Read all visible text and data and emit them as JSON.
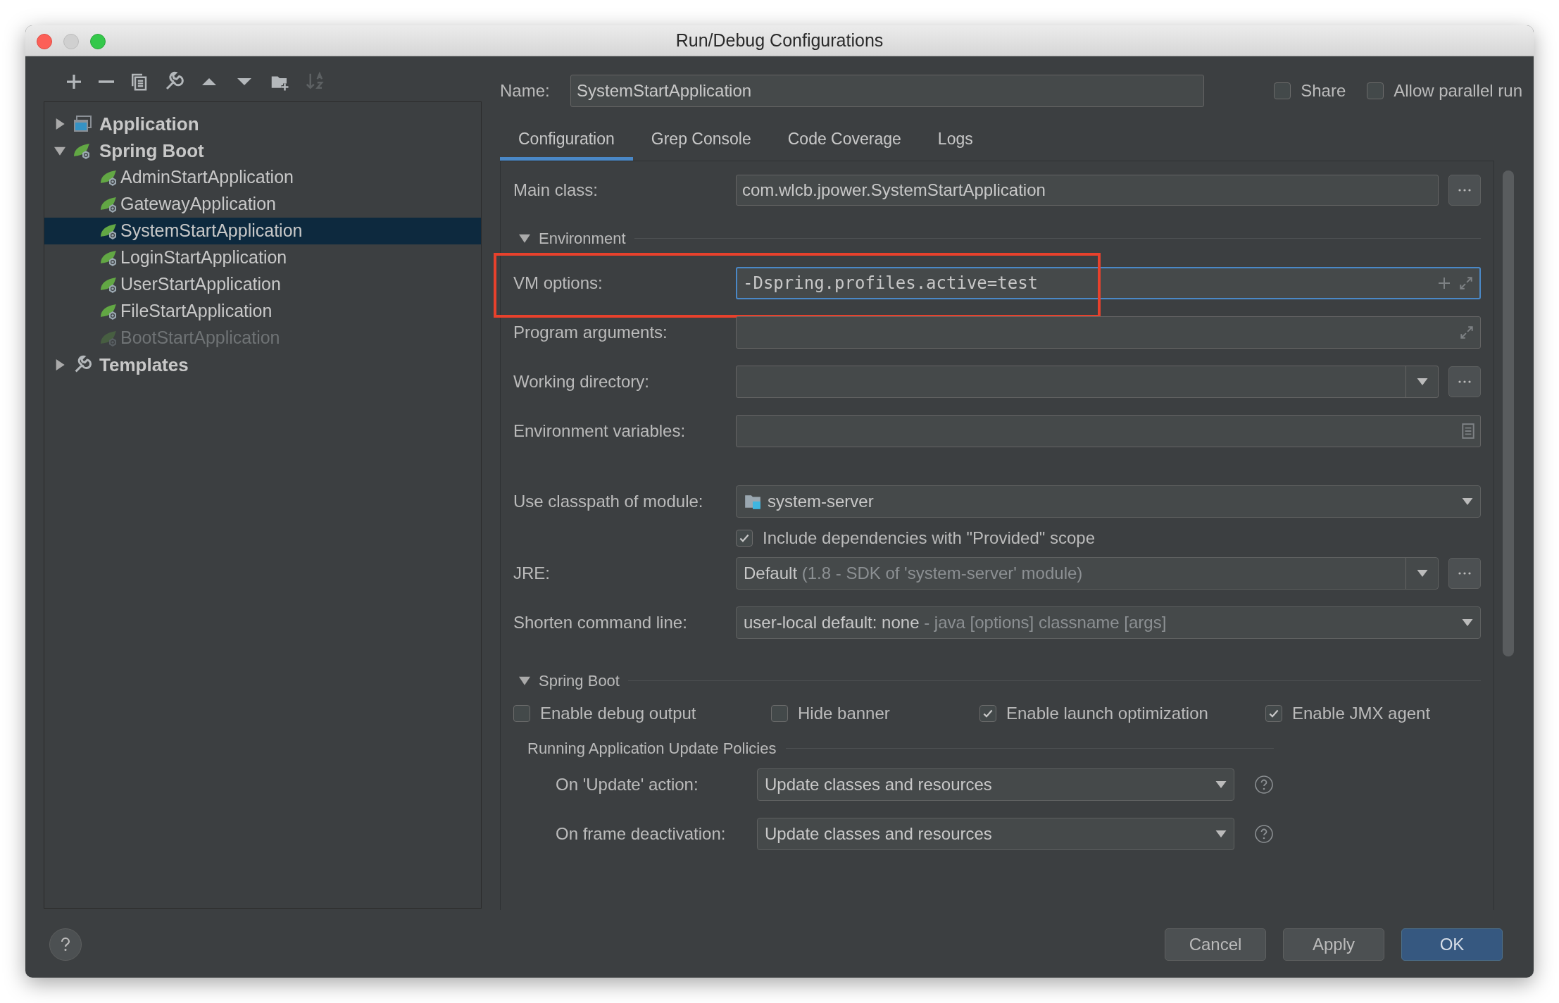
{
  "window": {
    "title": "Run/Debug Configurations"
  },
  "toolbar": [
    {
      "kind": "add",
      "disabled": false
    },
    {
      "kind": "remove",
      "disabled": false
    },
    {
      "kind": "copy",
      "disabled": false
    },
    {
      "kind": "edit",
      "disabled": false
    },
    {
      "kind": "up",
      "disabled": false
    },
    {
      "kind": "down",
      "disabled": false
    },
    {
      "kind": "folder",
      "disabled": false
    },
    {
      "kind": "sort",
      "disabled": true
    }
  ],
  "tree": [
    {
      "label": "Application",
      "kind": "application",
      "expanded": false,
      "selected": false
    },
    {
      "label": "Spring Boot",
      "kind": "spring",
      "expanded": true,
      "selected": false,
      "children": [
        {
          "label": "AdminStartApplication",
          "selected": false,
          "disabled": false
        },
        {
          "label": "GatewayApplication",
          "selected": false,
          "disabled": false
        },
        {
          "label": "SystemStartApplication",
          "selected": true,
          "disabled": false
        },
        {
          "label": "LoginStartApplication",
          "selected": false,
          "disabled": false
        },
        {
          "label": "UserStartApplication",
          "selected": false,
          "disabled": false
        },
        {
          "label": "FileStartApplication",
          "selected": false,
          "disabled": false
        },
        {
          "label": "BootStartApplication",
          "selected": false,
          "disabled": true
        }
      ]
    },
    {
      "label": "Templates",
      "kind": "templates",
      "expanded": false,
      "selected": false
    }
  ],
  "name_field": {
    "label": "Name:",
    "value": "SystemStartApplication"
  },
  "options": [
    {
      "label": "Share",
      "checked": false
    },
    {
      "label": "Allow parallel run",
      "checked": false
    }
  ],
  "tabs": [
    {
      "label": "Configuration",
      "selected": true
    },
    {
      "label": "Grep Console",
      "selected": false
    },
    {
      "label": "Code Coverage",
      "selected": false
    },
    {
      "label": "Logs",
      "selected": false
    }
  ],
  "main_class": {
    "label": "Main class:",
    "value": "com.wlcb.jpower.SystemStartApplication"
  },
  "environment": {
    "title": "Environment",
    "expanded": true,
    "fields": [
      {
        "kind": "options",
        "label": "VM options:",
        "value": "-Dspring.profiles.active=test",
        "focused": true,
        "highlighted": true
      },
      {
        "kind": "arguments",
        "label": "Program arguments:",
        "focused": false,
        "highlighted": false
      },
      {
        "kind": "directory",
        "label": "Working directory:",
        "focused": false,
        "highlighted": false
      },
      {
        "kind": "variables",
        "label": "Environment variables:",
        "focused": false,
        "highlighted": false
      }
    ]
  },
  "module": {
    "label": "Use classpath of module:",
    "value": "system-server"
  },
  "include_dependencies": {
    "label": "Include dependencies with \"Provided\" scope",
    "checked": true
  },
  "jre": {
    "label": "JRE:",
    "value": "Default",
    "hint": "(1.8 - SDK of 'system-server' module)"
  },
  "shorten": {
    "label": "Shorten command line:",
    "value": "user-local default: none",
    "hint": "- java [options] classname [args]"
  },
  "spring_boot": {
    "title": "Spring Boot",
    "expanded": true,
    "options": [
      {
        "label": "Enable debug output",
        "checked": false
      },
      {
        "label": "Hide banner",
        "checked": false
      },
      {
        "label": "Enable launch optimization",
        "checked": true
      },
      {
        "label": "Enable JMX agent",
        "checked": true
      }
    ],
    "policies": {
      "title": "Running Application Update Policies",
      "items": [
        {
          "label": "On 'Update' action:",
          "value": "Update classes and resources"
        },
        {
          "label": "On frame deactivation:",
          "value": "Update classes and resources"
        }
      ]
    }
  },
  "buttons": [
    {
      "label": "Cancel",
      "kind": "default"
    },
    {
      "label": "Apply",
      "kind": "default"
    },
    {
      "label": "OK",
      "kind": "primary"
    }
  ]
}
